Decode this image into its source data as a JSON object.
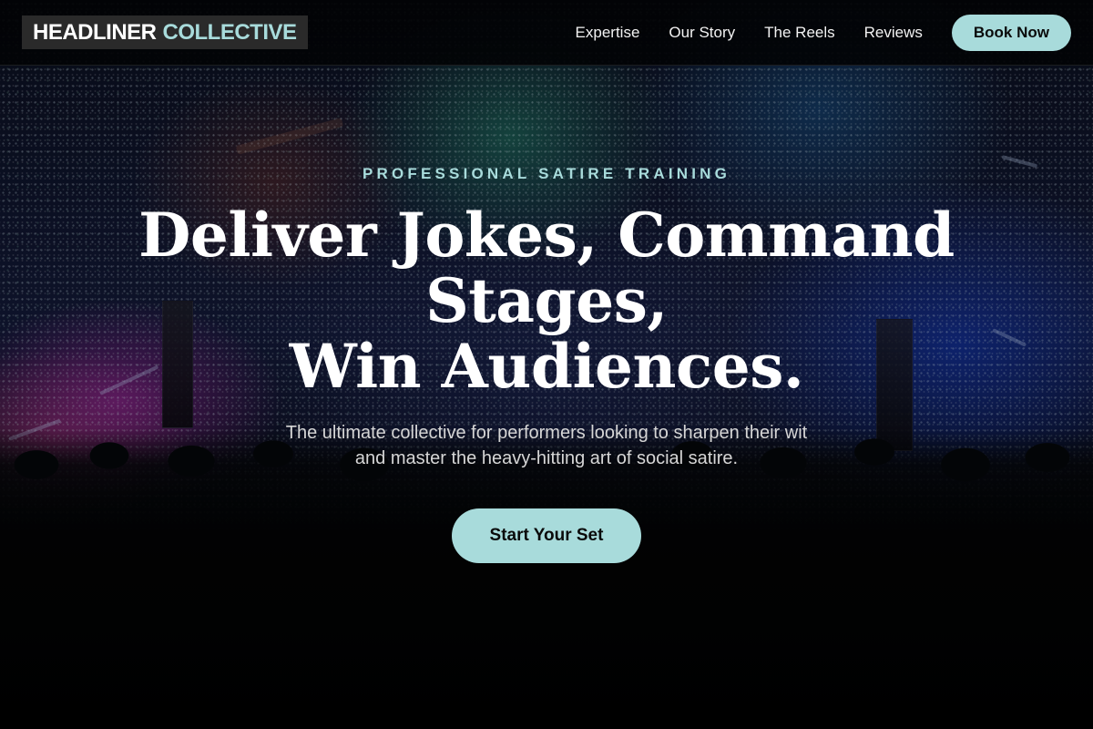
{
  "brand": {
    "name_primary": "HEADLINER",
    "name_accent": "COLLECTIVE"
  },
  "nav": {
    "links": [
      "Expertise",
      "Our Story",
      "The Reels",
      "Reviews"
    ],
    "cta_label": "Book Now"
  },
  "hero": {
    "eyebrow": "PROFESSIONAL SATIRE TRAINING",
    "headline_lines": [
      "Deliver Jokes, Command",
      "Stages,",
      "Win Audiences."
    ],
    "subtext_lines": [
      "The ultimate collective for performers looking to sharpen their wit",
      "and master the heavy-hitting art of social satire."
    ],
    "cta_label": "Start Your Set",
    "background_image": "concert-crowd-stage-lights"
  },
  "colors": {
    "accent": "#a8dbdb",
    "nav_background": "#020305",
    "logo_background": "#2a2a2a",
    "text_primary": "#ffffff",
    "text_secondary": "#d6d6d6"
  }
}
